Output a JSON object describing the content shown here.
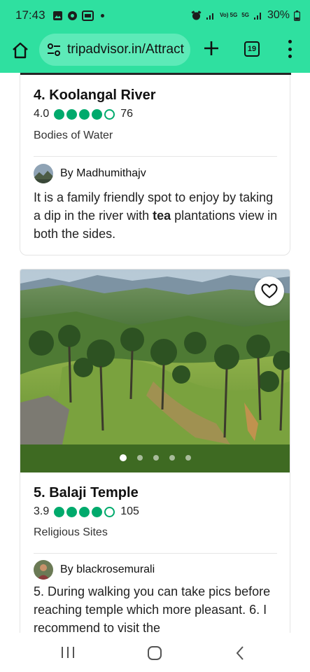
{
  "status_bar": {
    "time": "17:43",
    "network_label": "Vo) 5G",
    "signal_badge": "5G",
    "battery": "30%"
  },
  "toolbar": {
    "url": "tripadvisor.in/Attract",
    "tab_count": "19"
  },
  "attractions": [
    {
      "title": "4. Koolangal River",
      "rating": "4.0",
      "bubbles_filled": 4,
      "review_count": "76",
      "category": "Bodies of Water",
      "reviewer_prefix": "By",
      "reviewer": "Madhumithajv",
      "review_part1": "It is a family friendly spot to enjoy by taking a dip in the river with ",
      "review_bold": "tea",
      "review_part2": " plantations view in both the sides."
    },
    {
      "title": "5. Balaji Temple",
      "rating": "3.9",
      "bubbles_filled": 4,
      "review_count": "105",
      "category": "Religious Sites",
      "reviewer_prefix": "By",
      "reviewer": "blackrosemurali",
      "review_text": "5. During walking you can take pics before reaching temple which more pleasant. 6. I recommend to visit the",
      "photo_dots": 5,
      "active_dot": 0
    }
  ],
  "colors": {
    "chrome_green": "#2fe0a0",
    "url_pill": "#5deab8",
    "rating_green": "#00aa6c"
  }
}
